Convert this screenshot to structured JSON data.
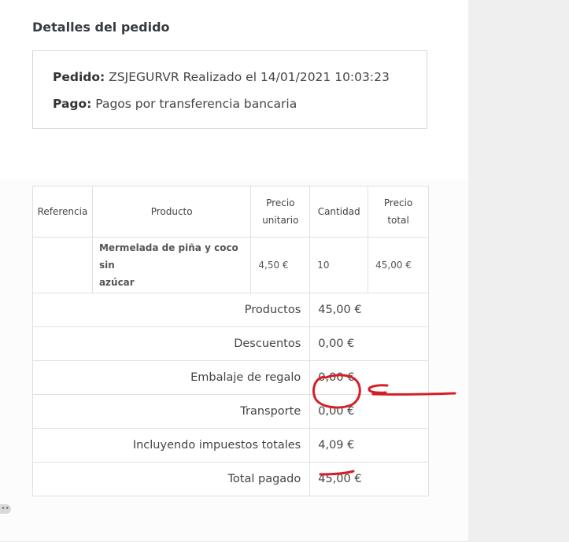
{
  "section": {
    "title": "Detalles del pedido"
  },
  "order_info": {
    "order_label": "Pedido:",
    "order_value": "ZSJEGURVR Realizado el 14/01/2021 10:03:23",
    "payment_label": "Pago:",
    "payment_value": "Pagos por transferencia bancaria"
  },
  "table": {
    "headers": {
      "reference": "Referencia",
      "product": "Producto",
      "unit_price_1": "Precio",
      "unit_price_2": "unitario",
      "quantity": "Cantidad",
      "total_price_1": "Precio",
      "total_price_2": "total"
    },
    "items": [
      {
        "reference": "",
        "product_line_1": "Mermelada de piña y coco sin",
        "product_line_2": "azúcar",
        "unit_price": "4,50 €",
        "quantity": "10",
        "total_price": "45,00 €"
      }
    ],
    "summary": [
      {
        "label": "Productos",
        "value": "45,00 €"
      },
      {
        "label": "Descuentos",
        "value": "0,00 €"
      },
      {
        "label": "Embalaje de regalo",
        "value": "0,00 €"
      },
      {
        "label": "Transporte",
        "value": "0,00 €"
      },
      {
        "label": "Incluyendo impuestos totales",
        "value": "4,09 €"
      },
      {
        "label": "Total pagado",
        "value": "45,00 €"
      }
    ]
  },
  "annotation": {
    "color": "#d41f26",
    "marks": [
      "circle-around-transporte-value",
      "arrow-pointing-left",
      "underline-total-paid"
    ]
  },
  "widgets": {
    "handle_glyph": "••"
  }
}
